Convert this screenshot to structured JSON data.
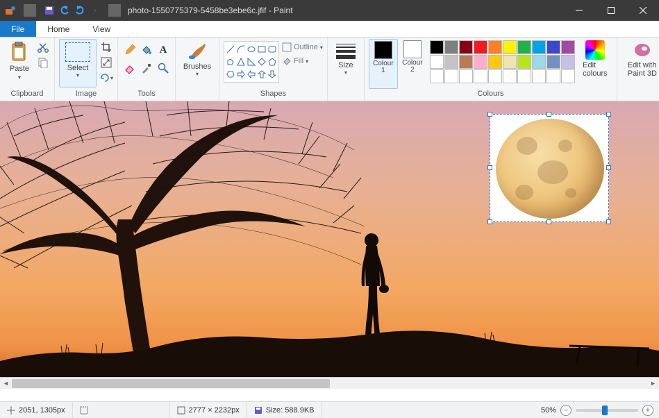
{
  "title_bar": {
    "document_title": "photo-1550775379-5458be3ebe6c.jfif - Paint"
  },
  "tabs": {
    "file": "File",
    "home": "Home",
    "view": "View"
  },
  "ribbon": {
    "clipboard": {
      "label": "Clipboard",
      "paste": "Paste"
    },
    "image": {
      "label": "Image",
      "select": "Select"
    },
    "tools": {
      "label": "Tools"
    },
    "brushes": {
      "label": "Brushes"
    },
    "shapes": {
      "label": "Shapes",
      "outline": "Outline",
      "fill": "Fill"
    },
    "size": {
      "label": "Size"
    },
    "colours": {
      "label": "Colours",
      "c1": "Colour\n1",
      "c2": "Colour\n2",
      "edit": "Edit\ncolours",
      "c1_hex": "#000000",
      "c2_hex": "#ffffff",
      "palette": [
        "#000000",
        "#7f7f7f",
        "#880015",
        "#ed1c24",
        "#ff7f27",
        "#fff200",
        "#22b14c",
        "#00a2e8",
        "#3f48cc",
        "#a349a4",
        "#ffffff",
        "#c3c3c3",
        "#b97a57",
        "#ffaec9",
        "#ffc90e",
        "#efe4b0",
        "#b5e61d",
        "#99d9ea",
        "#7092be",
        "#c8bfe7",
        "#ffffff",
        "#ffffff",
        "#ffffff",
        "#ffffff",
        "#ffffff",
        "#ffffff",
        "#ffffff",
        "#ffffff",
        "#ffffff",
        "#ffffff"
      ]
    },
    "paint3d": {
      "label": "Edit with\nPaint 3D"
    }
  },
  "status": {
    "cursor": "2051, 1305px",
    "selection": "",
    "dimensions": "2777 × 2232px",
    "filesize": "Size: 588.9KB",
    "zoom": "50%"
  }
}
